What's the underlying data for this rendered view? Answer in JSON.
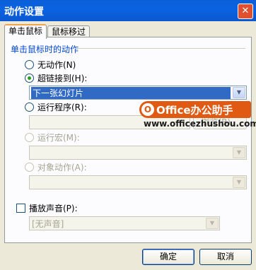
{
  "window": {
    "title": "动作设置",
    "close": "✕"
  },
  "tabs": [
    {
      "label": "单击鼠标"
    },
    {
      "label": "鼠标移过"
    }
  ],
  "group": {
    "label": "单击鼠标时的动作"
  },
  "options": {
    "none": "无动作(N)",
    "hyperlink": "超链接到(H):",
    "run_program": "运行程序(R):",
    "run_macro": "运行宏(M):",
    "object_action": "对象动作(A):"
  },
  "hyperlink_select": {
    "value": "下一张幻灯片"
  },
  "browse_button": "浏览(B)...",
  "play_sound": {
    "label": "播放声音(P):",
    "value": "[无声音]"
  },
  "buttons": {
    "ok": "确定",
    "cancel": "取消"
  },
  "watermark": {
    "brand": "Office办公助手",
    "url": "www.officezhushou.com"
  }
}
